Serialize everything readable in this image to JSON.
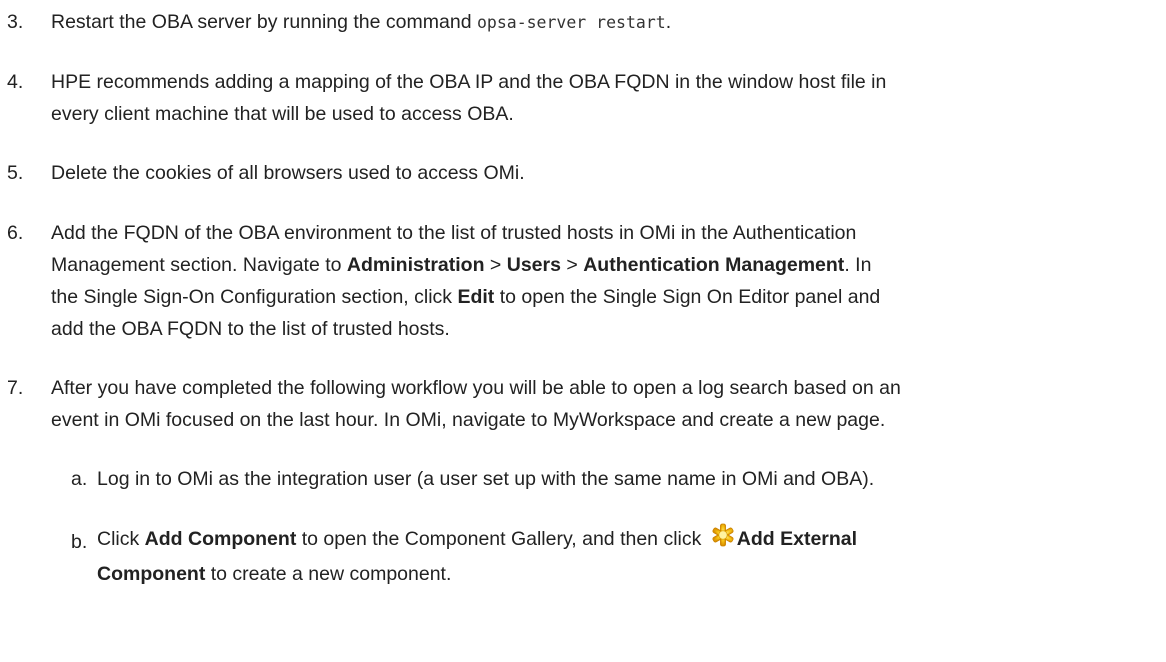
{
  "steps": [
    {
      "num": "3.",
      "pre": "Restart the OBA server by running the command ",
      "code": "opsa-server restart",
      "post": "."
    },
    {
      "num": "4.",
      "line1": "HPE recommends adding a mapping of the OBA IP and the OBA FQDN in the window host file in",
      "line2": "every client machine that will be used to access OBA."
    },
    {
      "num": "5.",
      "text": "Delete the cookies of all browsers used to access OMi."
    },
    {
      "num": "6.",
      "line1": "Add the FQDN of the OBA environment to the list of trusted hosts in OMi in the Authentication",
      "line2_pre": "Management section. Navigate to ",
      "bold1": "Administration",
      "sep1": " > ",
      "bold2": "Users",
      "sep2": " > ",
      "bold3": "Authentication Management",
      "line2_post": ". In",
      "line3_pre": "the Single Sign-On Configuration section, click ",
      "bold4": "Edit",
      "line3_post": " to open the Single Sign On Editor panel and",
      "line4": "add the OBA FQDN to the list of trusted hosts."
    },
    {
      "num": "7.",
      "line1": "After you have completed the following workflow you will be able to open a log search based on an",
      "line2": "event in OMi focused on the last hour. In OMi, navigate to MyWorkspace and create a new page."
    }
  ],
  "substeps": [
    {
      "num": "a.",
      "text": "Log in to OMi as the integration user (a user set up with the same name in OMi and OBA)."
    },
    {
      "num": "b.",
      "pre": "Click ",
      "bold1": "Add Component",
      "mid": " to open the Component Gallery, and then click ",
      "icon": "add-external-component-icon",
      "bold2": "Add External",
      "line2_bold": "Component",
      "line2_post": " to create a new component."
    }
  ],
  "colors": {
    "text": "#222222",
    "icon_yellow": "#f6c315"
  }
}
